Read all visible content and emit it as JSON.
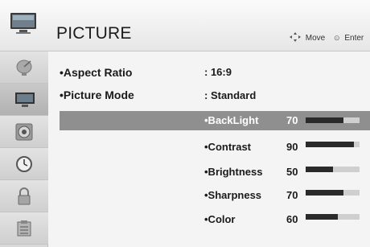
{
  "header": {
    "title": "PICTURE",
    "hint_move": "Move",
    "hint_enter": "Enter"
  },
  "sidebar": {
    "items": [
      {
        "icon": "satellite-dish-icon"
      },
      {
        "icon": "tv-icon",
        "active": true
      },
      {
        "icon": "speaker-icon"
      },
      {
        "icon": "clock-icon"
      },
      {
        "icon": "lock-icon"
      },
      {
        "icon": "options-icon"
      }
    ]
  },
  "menu": {
    "aspect_ratio": {
      "label": "•Aspect Ratio",
      "value": ": 16:9"
    },
    "picture_mode": {
      "label": "•Picture Mode",
      "value": ": Standard"
    },
    "settings": [
      {
        "label": "•BackLight",
        "value": "70",
        "level": 0.7,
        "highlighted": true
      },
      {
        "label": "•Contrast",
        "value": "90",
        "level": 0.9
      },
      {
        "label": "•Brightness",
        "value": "50",
        "level": 0.5
      },
      {
        "label": "•Sharpness",
        "value": "70",
        "level": 0.7
      },
      {
        "label": "•Color",
        "value": "60",
        "level": 0.6
      }
    ]
  }
}
